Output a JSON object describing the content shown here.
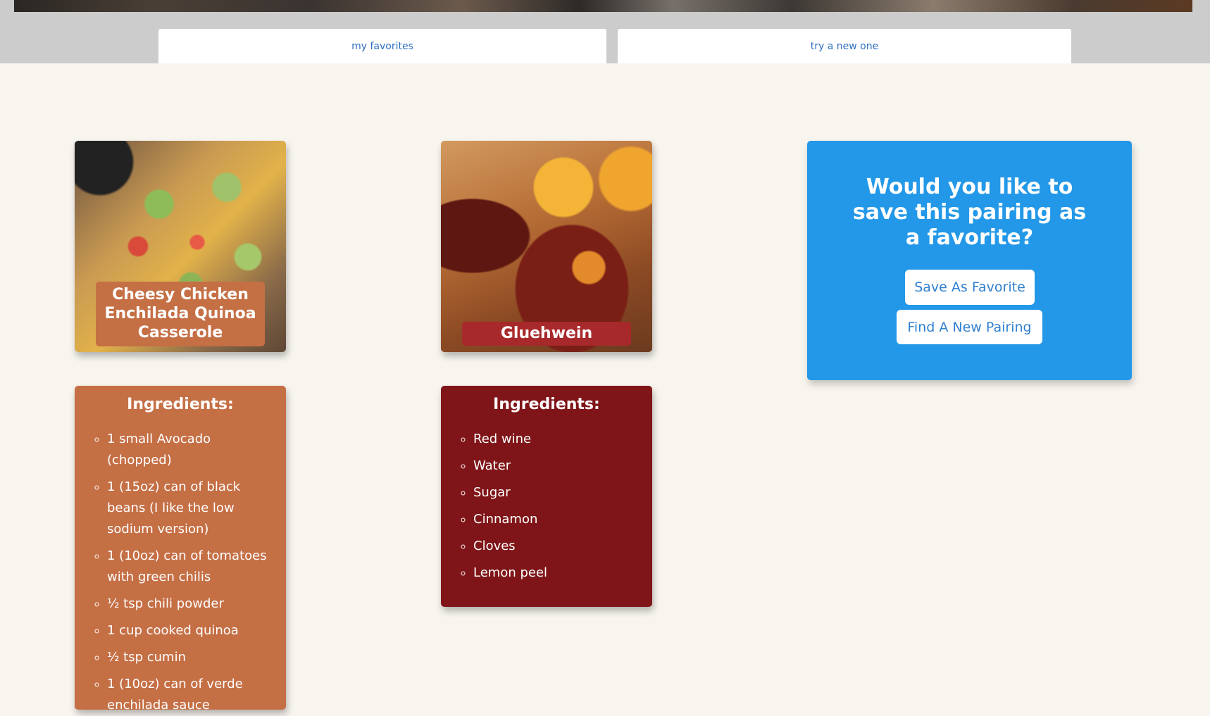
{
  "nav": {
    "favorites_label": "my favorites",
    "new_label": "try a new one"
  },
  "food": {
    "name": "Cheesy Chicken Enchilada Quinoa Casserole",
    "ingredients_heading": "Ingredients:",
    "ingredients": [
      "1 small Avocado (chopped)",
      "1 (15oz) can of black beans (I like the low sodium version)",
      "1 (10oz) can of tomatoes with green chilis",
      "½ tsp chili powder",
      "1 cup cooked quinoa",
      "½ tsp cumin",
      "1 (10oz) can of verde enchilada sauce"
    ]
  },
  "drink": {
    "name": "Gluehwein",
    "ingredients_heading": "Ingredients:",
    "ingredients": [
      "Red wine",
      "Water",
      "Sugar",
      "Cinnamon",
      "Cloves",
      "Lemon peel"
    ]
  },
  "favorite_panel": {
    "question": "Would you like to save this pairing as a favorite?",
    "save_label": "Save As Favorite",
    "find_label": "Find A New Pairing"
  },
  "colors": {
    "food_card": "#c56f45",
    "drink_card": "#7f1518",
    "drink_label": "#a8292b",
    "panel": "#2398e8",
    "link": "#2f6fc0"
  }
}
